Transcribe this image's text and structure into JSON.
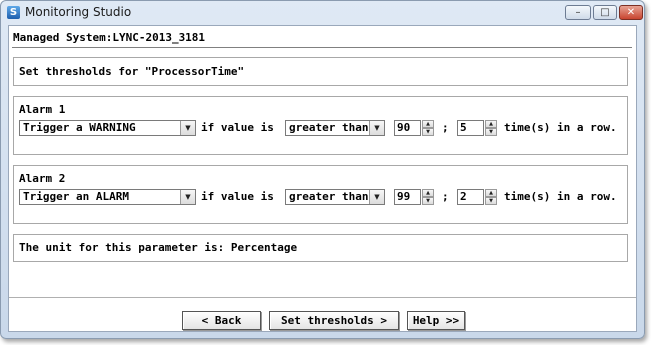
{
  "window": {
    "title": "Monitoring Studio",
    "app_icon_glyph": "S",
    "minimize_glyph": "–",
    "maximize_glyph": "□",
    "close_glyph": "✕"
  },
  "header": {
    "managed_system": "Managed System:LYNC-2013_3181"
  },
  "instructions": "Set thresholds for \"ProcessorTime\"",
  "alarms": [
    {
      "label": "Alarm 1",
      "action": "Trigger a WARNING",
      "if_text": "if value is",
      "comparison": "greater than",
      "value": "90",
      "separator": ";",
      "count": "5",
      "suffix": "time(s) in a row."
    },
    {
      "label": "Alarm 2",
      "action": "Trigger an ALARM",
      "if_text": "if value is",
      "comparison": "greater than",
      "value": "99",
      "separator": ";",
      "count": "2",
      "suffix": "time(s) in a row."
    }
  ],
  "unit_text": "The unit for this parameter is: Percentage",
  "buttons": {
    "back": "< Back",
    "set_thresholds": "Set thresholds >",
    "help": "Help >>"
  },
  "icons": {
    "dropdown": "chevron-down-icon",
    "spin_up": "spin-up-icon",
    "spin_down": "spin-down-icon"
  }
}
